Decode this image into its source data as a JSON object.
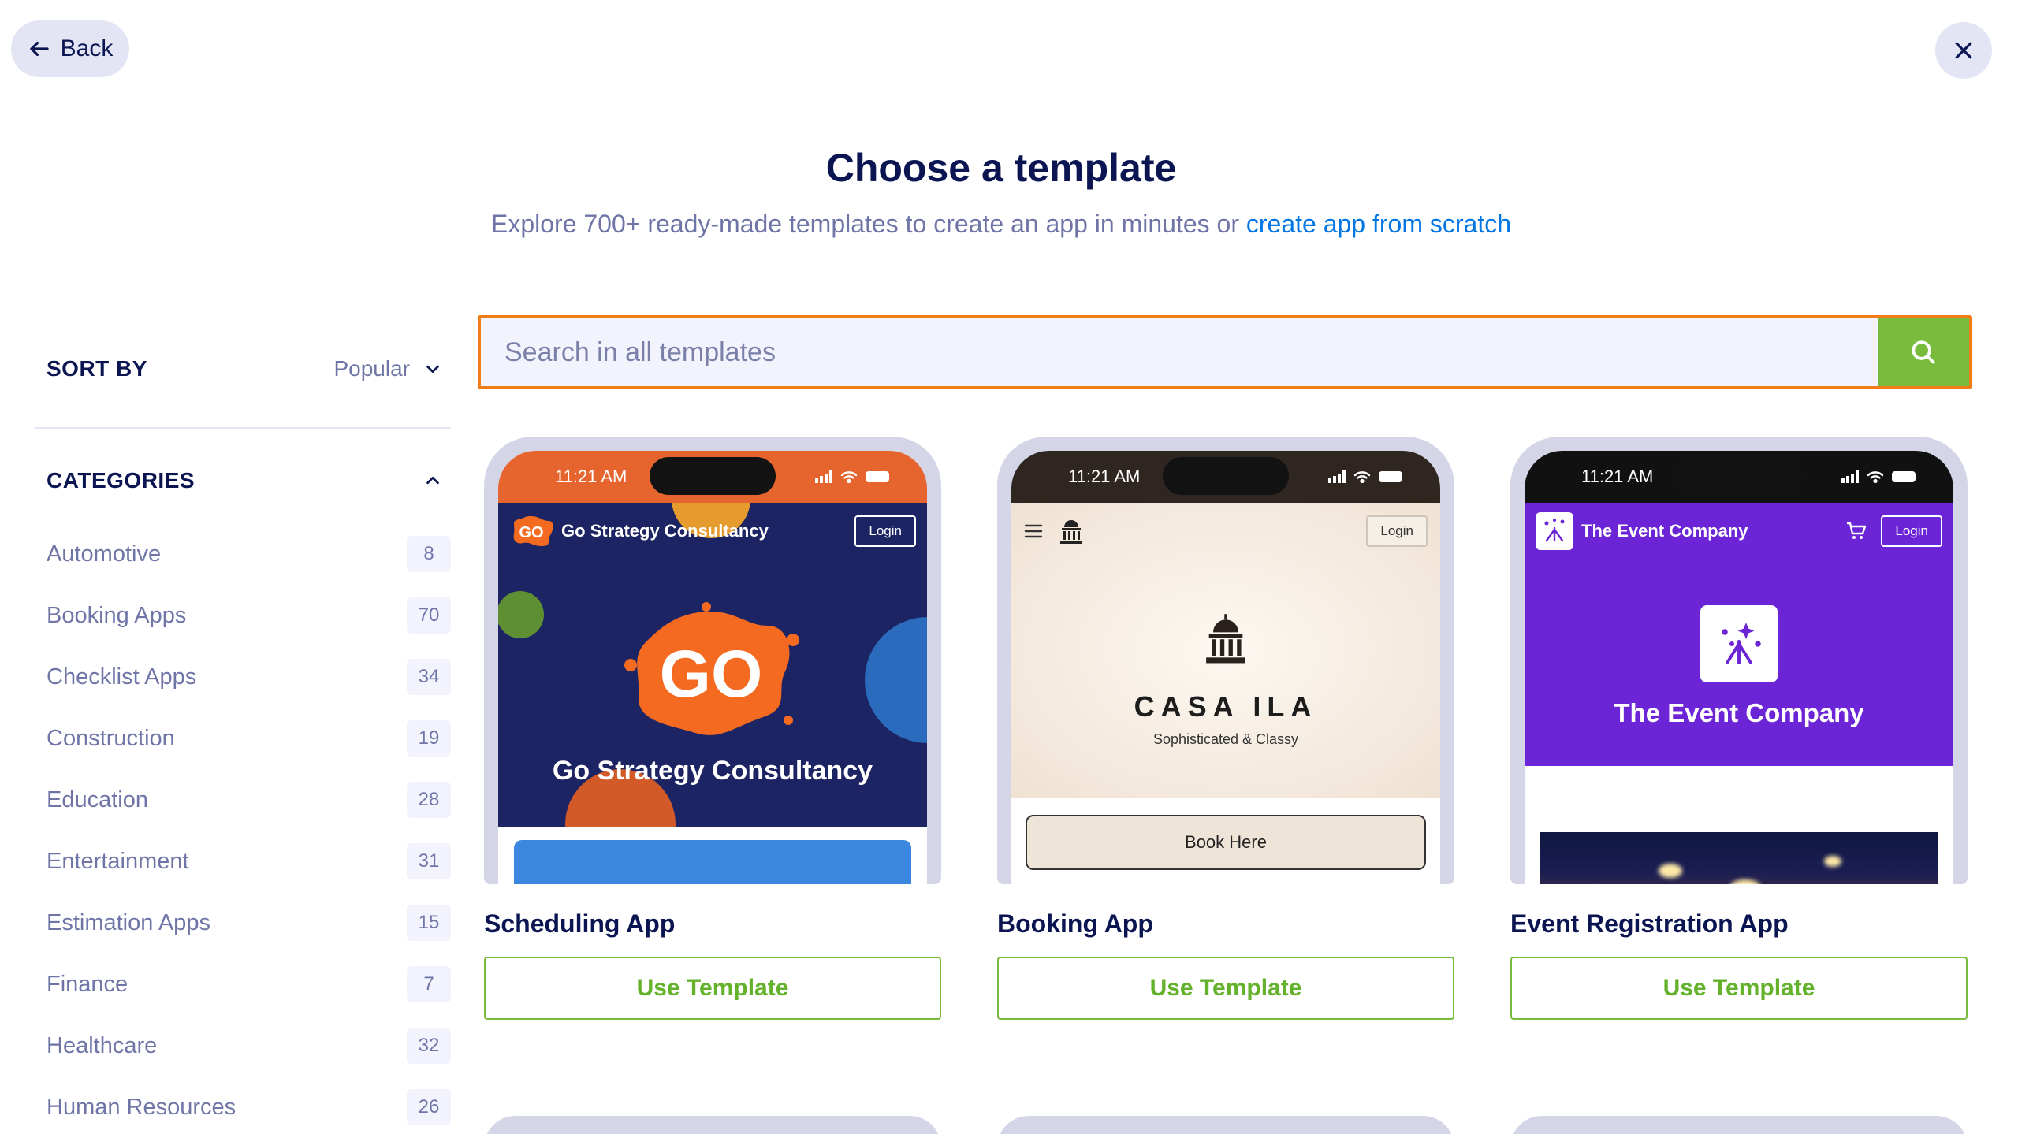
{
  "nav": {
    "back_label": "Back"
  },
  "header": {
    "title": "Choose a template",
    "subtitle_text": "Explore 700+ ready-made templates to create an app in minutes or",
    "subtitle_link": "create app from scratch"
  },
  "sort": {
    "label": "SORT BY",
    "value": "Popular"
  },
  "categories": {
    "title": "CATEGORIES",
    "items": [
      {
        "label": "Automotive",
        "count": "8"
      },
      {
        "label": "Booking Apps",
        "count": "70"
      },
      {
        "label": "Checklist Apps",
        "count": "34"
      },
      {
        "label": "Construction",
        "count": "19"
      },
      {
        "label": "Education",
        "count": "28"
      },
      {
        "label": "Entertainment",
        "count": "31"
      },
      {
        "label": "Estimation Apps",
        "count": "15"
      },
      {
        "label": "Finance",
        "count": "7"
      },
      {
        "label": "Healthcare",
        "count": "32"
      },
      {
        "label": "Human Resources",
        "count": "26"
      }
    ]
  },
  "search": {
    "placeholder": "Search in all templates"
  },
  "templates": [
    {
      "name": "Scheduling App",
      "button": "Use Template",
      "preview": {
        "time": "11:21 AM",
        "brand": "Go Strategy Consultancy",
        "login": "Login",
        "logo_text": "GO",
        "hero_title": "Go Strategy Consultancy"
      }
    },
    {
      "name": "Booking App",
      "button": "Use Template",
      "preview": {
        "time": "11:21 AM",
        "login": "Login",
        "title": "CASA ILA",
        "tagline": "Sophisticated & Classy",
        "cta": "Book Here"
      }
    },
    {
      "name": "Event Registration App",
      "button": "Use Template",
      "preview": {
        "time": "11:21 AM",
        "brand": "The Event Company",
        "login": "Login",
        "hero_title": "The Event Company"
      }
    }
  ],
  "colors": {
    "accent_orange": "#f27c16",
    "green": "#78bb3d",
    "navy": "#0a1551",
    "link_blue": "#0075e3"
  }
}
